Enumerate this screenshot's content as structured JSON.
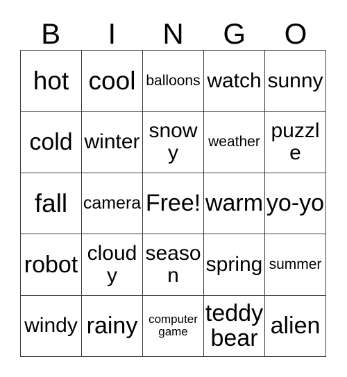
{
  "card": {
    "header": {
      "letters": [
        "B",
        "I",
        "N",
        "G",
        "O"
      ]
    },
    "grid": {
      "rows": 5,
      "columns": 5,
      "free_space": "Free!",
      "cells": [
        [
          {
            "text": "hot",
            "size": "fs-xl"
          },
          {
            "text": "cool",
            "size": "fs-xl"
          },
          {
            "text": "balloons",
            "size": "fs-xs"
          },
          {
            "text": "watch",
            "size": "fs-md"
          },
          {
            "text": "sunny",
            "size": "fs-md"
          }
        ],
        [
          {
            "text": "cold",
            "size": "fs-lg"
          },
          {
            "text": "winter",
            "size": "fs-md"
          },
          {
            "text": "snowy",
            "size": "fs-md"
          },
          {
            "text": "weather",
            "size": "fs-xs"
          },
          {
            "text": "puzzle",
            "size": "fs-md"
          }
        ],
        [
          {
            "text": "fall",
            "size": "fs-xl"
          },
          {
            "text": "camera",
            "size": "fs-sm"
          },
          {
            "text": "Free!",
            "size": "fs-lg"
          },
          {
            "text": "warm",
            "size": "fs-lg"
          },
          {
            "text": "yo-yo",
            "size": "fs-lg"
          }
        ],
        [
          {
            "text": "robot",
            "size": "fs-lg"
          },
          {
            "text": "cloudy",
            "size": "fs-md"
          },
          {
            "text": "season",
            "size": "fs-md"
          },
          {
            "text": "spring",
            "size": "fs-md"
          },
          {
            "text": "summer",
            "size": "fs-xs"
          }
        ],
        [
          {
            "text": "windy",
            "size": "fs-md"
          },
          {
            "text": "rainy",
            "size": "fs-lg"
          },
          {
            "text": "computer game",
            "size": "fs-xxs"
          },
          {
            "text": "teddy bear",
            "size": "fs-lg"
          },
          {
            "text": "alien",
            "size": "fs-lg"
          }
        ]
      ]
    },
    "colors": {
      "background": "#ffffff",
      "text": "#000000",
      "grid_line": "#3a3a3a"
    }
  }
}
